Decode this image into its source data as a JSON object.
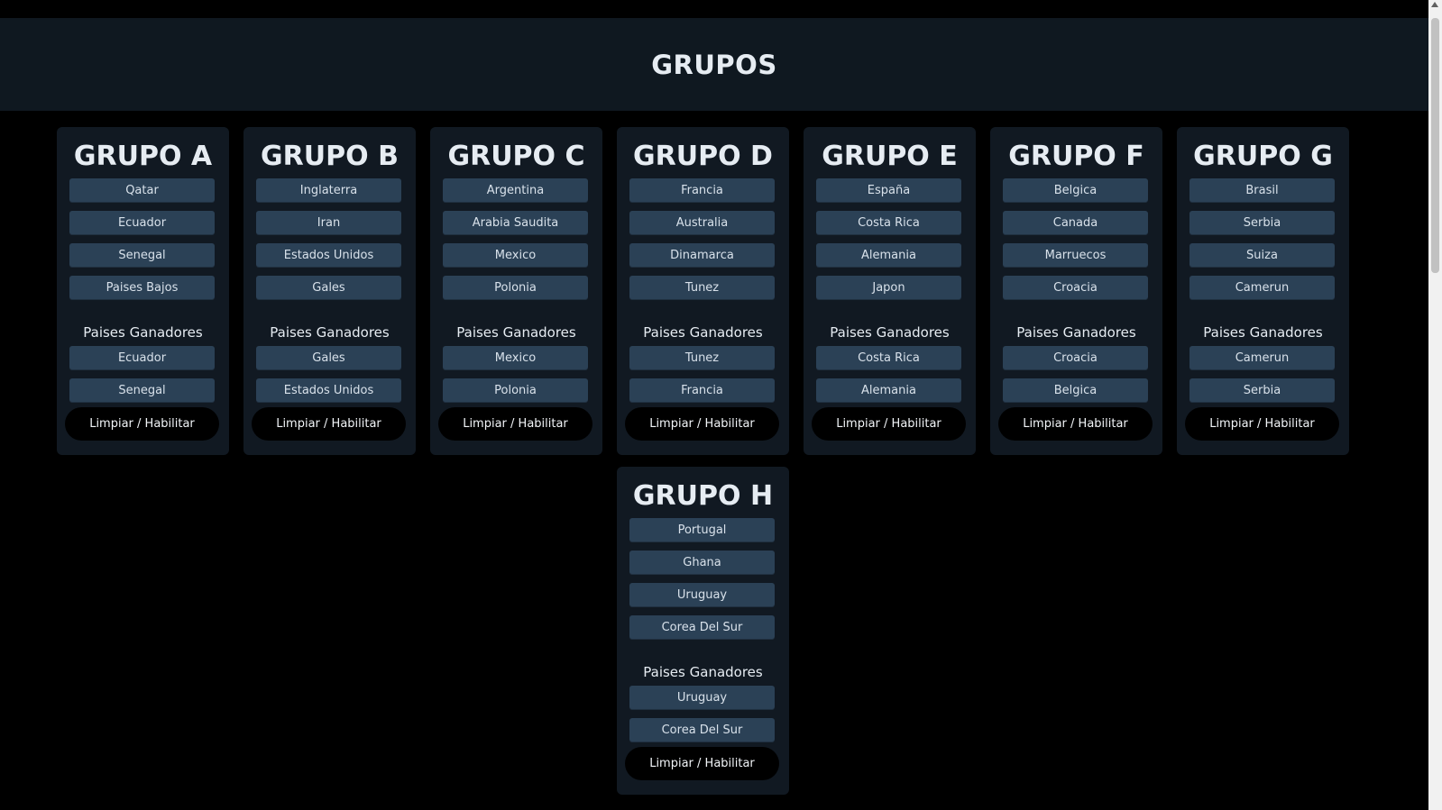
{
  "header": {
    "title": "GRUPOS"
  },
  "groups": [
    {
      "title": "GRUPO A",
      "teams": [
        "Qatar",
        "Ecuador",
        "Senegal",
        "Paises Bajos"
      ],
      "winners_label": "Paises Ganadores",
      "winners": [
        "Ecuador",
        "Senegal"
      ],
      "reset_label": "Limpiar / Habilitar"
    },
    {
      "title": "GRUPO B",
      "teams": [
        "Inglaterra",
        "Iran",
        "Estados Unidos",
        "Gales"
      ],
      "winners_label": "Paises Ganadores",
      "winners": [
        "Gales",
        "Estados Unidos"
      ],
      "reset_label": "Limpiar / Habilitar"
    },
    {
      "title": "GRUPO C",
      "teams": [
        "Argentina",
        "Arabia Saudita",
        "Mexico",
        "Polonia"
      ],
      "winners_label": "Paises Ganadores",
      "winners": [
        "Mexico",
        "Polonia"
      ],
      "reset_label": "Limpiar / Habilitar"
    },
    {
      "title": "GRUPO D",
      "teams": [
        "Francia",
        "Australia",
        "Dinamarca",
        "Tunez"
      ],
      "winners_label": "Paises Ganadores",
      "winners": [
        "Tunez",
        "Francia"
      ],
      "reset_label": "Limpiar / Habilitar"
    },
    {
      "title": "GRUPO E",
      "teams": [
        "España",
        "Costa Rica",
        "Alemania",
        "Japon"
      ],
      "winners_label": "Paises Ganadores",
      "winners": [
        "Costa Rica",
        "Alemania"
      ],
      "reset_label": "Limpiar / Habilitar"
    },
    {
      "title": "GRUPO F",
      "teams": [
        "Belgica",
        "Canada",
        "Marruecos",
        "Croacia"
      ],
      "winners_label": "Paises Ganadores",
      "winners": [
        "Croacia",
        "Belgica"
      ],
      "reset_label": "Limpiar / Habilitar"
    },
    {
      "title": "GRUPO G",
      "teams": [
        "Brasil",
        "Serbia",
        "Suiza",
        "Camerun"
      ],
      "winners_label": "Paises Ganadores",
      "winners": [
        "Camerun",
        "Serbia"
      ],
      "reset_label": "Limpiar / Habilitar"
    },
    {
      "title": "GRUPO H",
      "teams": [
        "Portugal",
        "Ghana",
        "Uruguay",
        "Corea Del Sur"
      ],
      "winners_label": "Paises Ganadores",
      "winners": [
        "Uruguay",
        "Corea Del Sur"
      ],
      "reset_label": "Limpiar / Habilitar"
    }
  ]
}
